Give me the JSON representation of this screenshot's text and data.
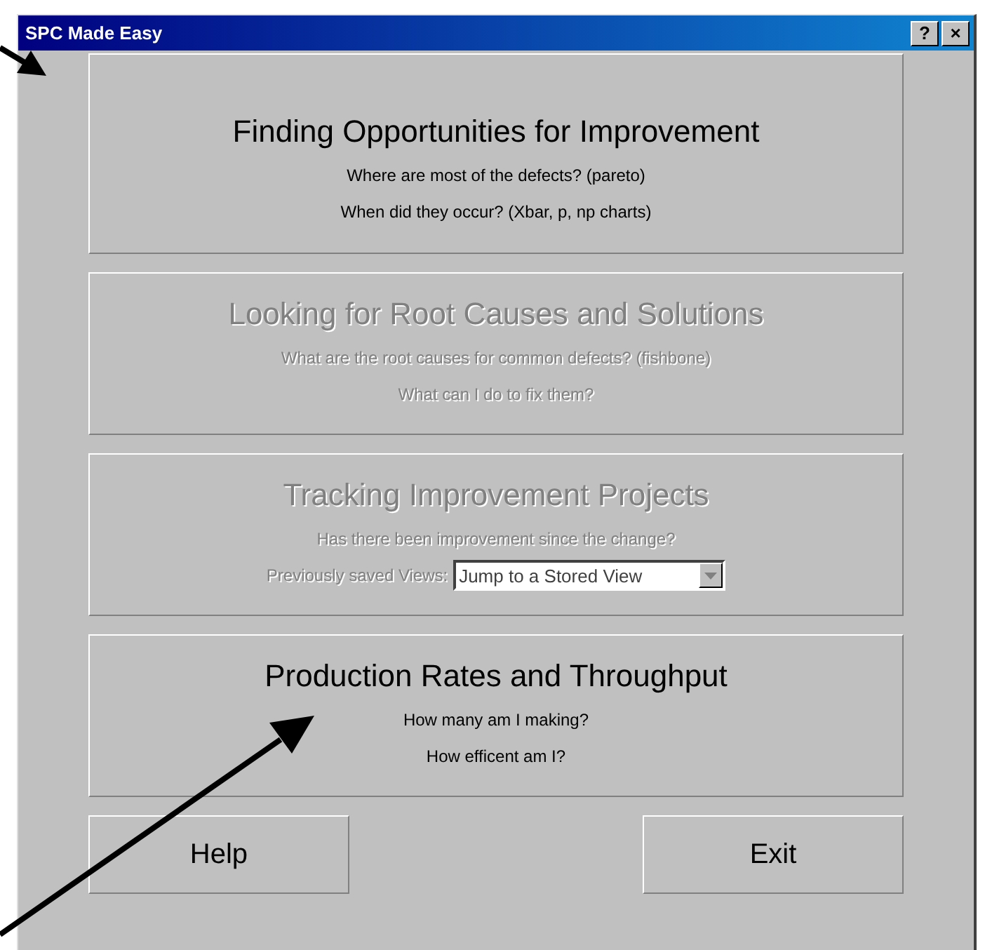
{
  "window": {
    "title": "SPC Made Easy",
    "title_buttons": [
      "?",
      "×"
    ]
  },
  "panels": [
    {
      "title": "Finding Opportunities for Improvement",
      "lines": [
        "Where are most of the defects? (pareto)",
        "When did they occur? (Xbar, p, np charts)"
      ],
      "enabled": true
    },
    {
      "title": "Looking for Root Causes and Solutions",
      "lines": [
        "What are the root causes for common defects? (fishbone)",
        "What can I do to fix them?"
      ],
      "enabled": false
    },
    {
      "title": "Tracking Improvement Projects",
      "lines": [
        "Has there been improvement since the change?"
      ],
      "enabled": false,
      "view_selector": {
        "label": "Previously saved Views:",
        "value": "Jump to a Stored View"
      }
    },
    {
      "title": "Production Rates and Throughput",
      "lines": [
        "How many am I making?",
        "How efficent am I?"
      ],
      "enabled": true
    }
  ],
  "buttons": [
    "Help",
    "Exit"
  ]
}
